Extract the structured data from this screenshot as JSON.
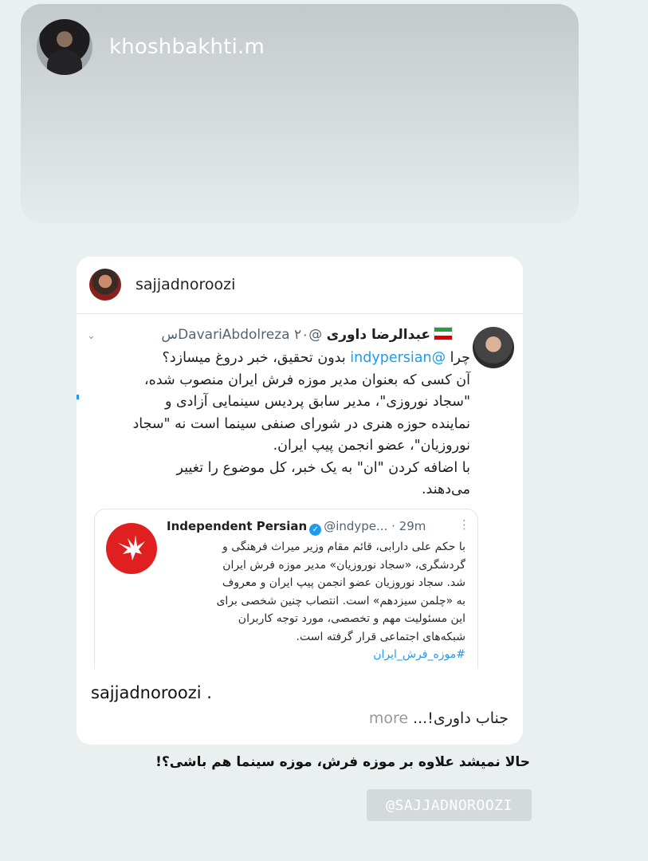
{
  "story": {
    "username": "khoshbakhti.m"
  },
  "post": {
    "username": "sajjadnoroozi",
    "tweet": {
      "name": "عبدالرضا داوری",
      "handle": "@DavariAbdolreza",
      "time": "۲۰س",
      "lines": [
        {
          "pre": "چرا ",
          "mention": "@indypersian",
          "post": " بدون تحقیق، خبر دروغ میسازد؟"
        },
        {
          "text": "آن کسی که بعنوان مدیر موزه فرش ایران منصوب شده،"
        },
        {
          "text": "\"سجاد نوروزی\"، مدیر سابق پردیس سینمایی آزادی و"
        },
        {
          "text": "نماینده حوزه هنری در شورای صنفی سینما است نه \"سجاد"
        },
        {
          "text": "نوروزیان\"، عضو انجمن پیپ ایران."
        },
        {
          "text": "با اضافه کردن \"ان\" به یک خبر، کل موضوع را تغییر"
        },
        {
          "text": "می‌دهند."
        }
      ],
      "quoted": {
        "name": "Independent Persian",
        "handle": "@indype...",
        "time": "· 29m",
        "lines": [
          "با حکم علی دارابی، قائم مقام وزیر میراث فرهنگی و",
          "گردشگری، «سجاد نوروزیان» مدیر موزه فرش ایران",
          "شد. سجاد نوروزیان عضو انجمن پیپ ایران و معروف",
          "به «چلمن سیزدهم» است. انتصاب چنین شخصی برای",
          "این مسئولیت مهم و تخصصی، مورد توجه کاربران",
          "شبکه‌های اجتماعی قرار گرفته است."
        ],
        "hashtag": "#موزه_فرش_ایران"
      }
    },
    "caption_username": "sajjadnoroozi",
    "caption_sep": ".",
    "caption_text": "جناب داوری!...",
    "caption_more": "more"
  },
  "story_text": "حالا نمیشد علاوه بر موزه فرش، موزه سینما هم باشی؟!",
  "watermark": "@SAJJADNOROOZI",
  "colors": {
    "link": "#1d9bf0",
    "independent_red": "#e02020"
  }
}
